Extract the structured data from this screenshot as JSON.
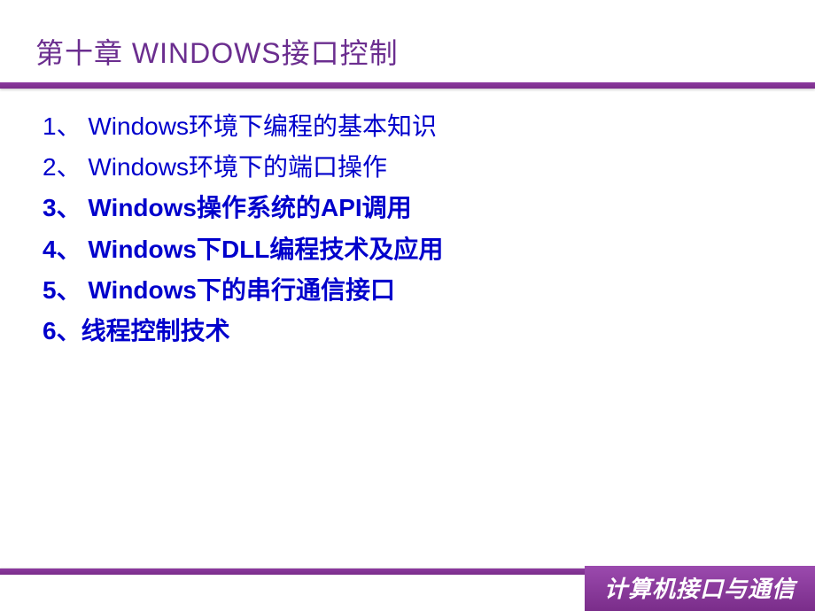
{
  "title": "第十章 WINDOWS接口控制",
  "items": [
    {
      "number": "1、",
      "text": " Windows环境下编程的基本知识",
      "bold": false
    },
    {
      "number": "2、",
      "text": " Windows环境下的端口操作",
      "bold": false
    },
    {
      "number": "3、",
      "text": " Windows操作系统的API调用",
      "bold": true
    },
    {
      "number": "4、",
      "text": " Windows下DLL编程技术及应用",
      "bold": true
    },
    {
      "number": "5、",
      "text": " Windows下的串行通信接口",
      "bold": true
    },
    {
      "number": "6、",
      "text": "线程控制技术",
      "bold": true
    }
  ],
  "footer": "计算机接口与通信"
}
